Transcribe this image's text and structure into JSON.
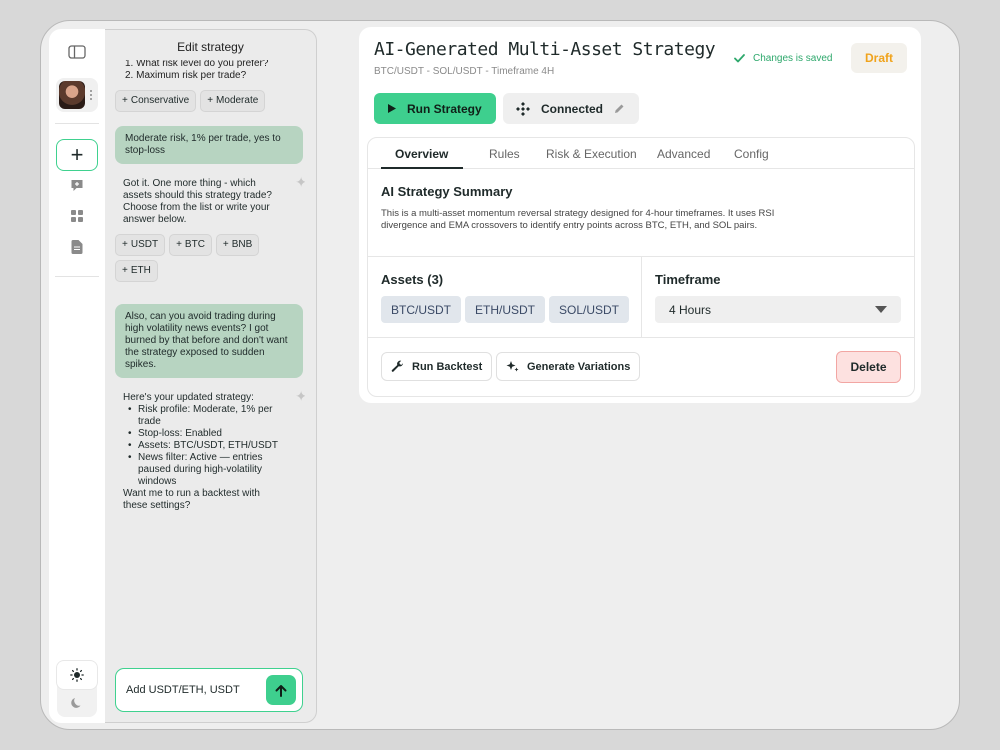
{
  "chat": {
    "title": "Edit strategy",
    "cut_lines": [
      "1. What risk level do you prefer?",
      "2. Maximum risk per trade?"
    ],
    "risk_chips": [
      "Conservative",
      "Moderate"
    ],
    "user_msg_1": "Moderate risk, 1% per trade, yes to stop-loss",
    "ai_msg_1": "Got it. One more thing - which assets should this strategy trade? Choose from the list or write your answer below.",
    "asset_chips": [
      "USDT",
      "BTC",
      "BNB",
      "ETH"
    ],
    "user_msg_2": "Also, can you avoid trading during high volatility news events? I got burned by that before and don't want the strategy exposed to sudden spikes.",
    "ai_msg_2_intro": "Here's your updated strategy:",
    "ai_msg_2_items": [
      "Risk profile: Moderate, 1% per trade",
      "Stop-loss: Enabled",
      "Assets: BTC/USDT, ETH/USDT",
      "News filter: Active — entries paused during high-volatility windows"
    ],
    "ai_msg_2_outro": "Want me to run a backtest with these settings?",
    "input_value": "Add USDT/ETH, USDT"
  },
  "strategy": {
    "title": "AI-Generated Multi-Asset Strategy",
    "subtitle": "BTC/USDT - SOL/USDT - Timeframe 4H",
    "saved_status": "Changes is saved",
    "draft_label": "Draft",
    "run_label": "Run Strategy",
    "connected_label": "Connected"
  },
  "tabs": [
    "Overview",
    "Rules",
    "Risk & Execution",
    "Advanced",
    "Config"
  ],
  "summary": {
    "title": "AI Strategy Summary",
    "text": "This is a multi-asset momentum reversal strategy designed for 4-hour timeframes. It uses RSI divergence and EMA crossovers to identify entry points across BTC, ETH, and SOL pairs."
  },
  "assets": {
    "title": "Assets (3)",
    "items": [
      "BTC/USDT",
      "ETH/USDT",
      "SOL/USDT"
    ]
  },
  "timeframe": {
    "title": "Timeframe",
    "value": "4 Hours"
  },
  "actions": {
    "backtest_label": "Run Backtest",
    "variations_label": "Generate Variations",
    "delete_label": "Delete"
  },
  "colors": {
    "accent": "#3ecf8e",
    "user_bubble": "#b7d4c1",
    "draft": "#f0a31c",
    "delete_bg": "#fde1e0"
  }
}
